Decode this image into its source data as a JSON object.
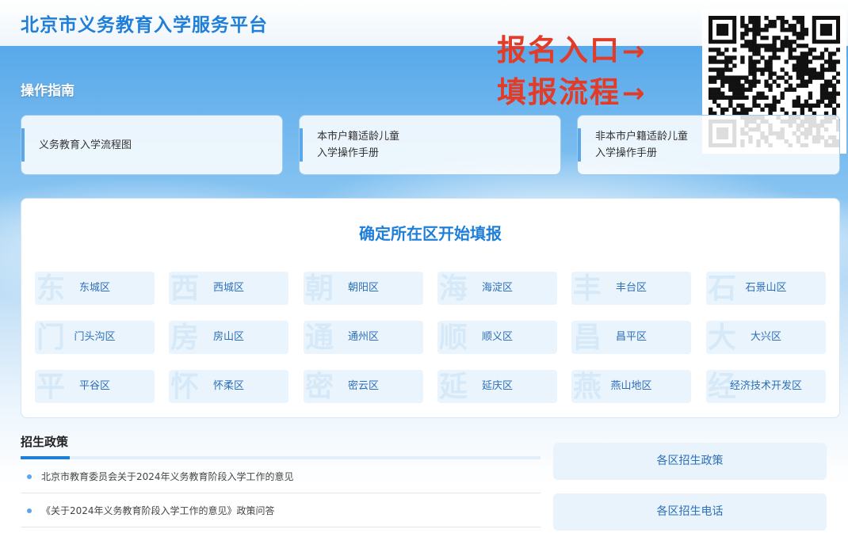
{
  "site": {
    "title": "北京市义务教育入学服务平台"
  },
  "promo": {
    "line1": "报名入口",
    "line2": "填报流程",
    "arrow": "→"
  },
  "guide": {
    "title": "操作指南",
    "cards": [
      {
        "line1": "义务教育入学流程图",
        "line2": ""
      },
      {
        "line1": "本市户籍适龄儿童",
        "line2": "入学操作手册"
      },
      {
        "line1": "非本市户籍适龄儿童",
        "line2": "入学操作手册"
      }
    ]
  },
  "district_section": {
    "title": "确定所在区开始填报",
    "districts": [
      {
        "label": "东城区",
        "watermark": "东"
      },
      {
        "label": "西城区",
        "watermark": "西"
      },
      {
        "label": "朝阳区",
        "watermark": "朝"
      },
      {
        "label": "海淀区",
        "watermark": "海"
      },
      {
        "label": "丰台区",
        "watermark": "丰"
      },
      {
        "label": "石景山区",
        "watermark": "石"
      },
      {
        "label": "门头沟区",
        "watermark": "门"
      },
      {
        "label": "房山区",
        "watermark": "房"
      },
      {
        "label": "通州区",
        "watermark": "通"
      },
      {
        "label": "顺义区",
        "watermark": "顺"
      },
      {
        "label": "昌平区",
        "watermark": "昌"
      },
      {
        "label": "大兴区",
        "watermark": "大"
      },
      {
        "label": "平谷区",
        "watermark": "平"
      },
      {
        "label": "怀柔区",
        "watermark": "怀"
      },
      {
        "label": "密云区",
        "watermark": "密"
      },
      {
        "label": "延庆区",
        "watermark": "延"
      },
      {
        "label": "燕山地区",
        "watermark": "燕"
      },
      {
        "label": "经济技术开发区",
        "watermark": "经"
      }
    ]
  },
  "policy": {
    "title": "招生政策",
    "items": [
      "北京市教育委员会关于2024年义务教育阶段入学工作的意见",
      "《关于2024年义务教育阶段入学工作的意见》政策问答"
    ]
  },
  "side_buttons": [
    "各区招生政策",
    "各区招生电话"
  ],
  "colors": {
    "brand_blue": "#1f7fd8",
    "promo_red": "#e23b27"
  }
}
